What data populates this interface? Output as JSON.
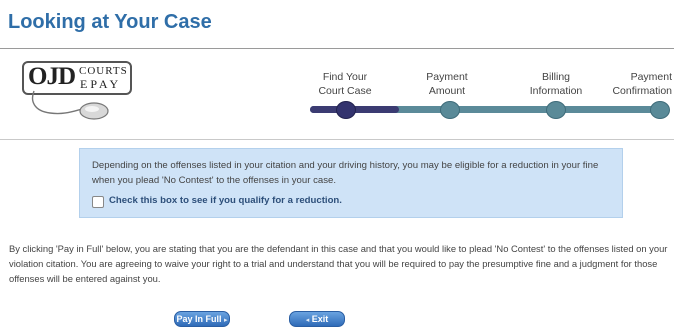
{
  "page": {
    "title": "Looking at Your Case"
  },
  "logo": {
    "main": "OJD",
    "top": "COURTS",
    "bottom": "EPAY"
  },
  "steps": [
    {
      "line1": "Find Your",
      "line2": "Court Case"
    },
    {
      "line1": "Payment",
      "line2": "Amount"
    },
    {
      "line1": "Billing",
      "line2": "Information"
    },
    {
      "line1": "Payment",
      "line2": "Confirmation"
    }
  ],
  "progress": {
    "current_step": 1,
    "total_steps": 4,
    "fill_fraction": 0.25
  },
  "notice": {
    "text": "Depending on the offenses listed in your citation and your driving history, you may be eligible for a reduction in your fine when you plead 'No Contest' to the offenses in your case.",
    "checkbox_label": "Check this box to see if you qualify for a reduction.",
    "checked": false
  },
  "legal_text": "By clicking 'Pay in Full' below, you are stating that you are the defendant in this case and that you would like to plead 'No Contest' to the offenses listed on your violation citation. You are agreeing to waive your right to a trial and understand that you will be required to pay the presumptive fine and a judgment for those offenses will be entered against you.",
  "buttons": {
    "pay_in_full": "Pay In Full",
    "exit": "Exit"
  },
  "colors": {
    "title": "#2f6ea8",
    "notice_bg": "#cfe3f7",
    "progress_done": "#33336e",
    "progress_todo": "#5a8a98",
    "button": "#2f6bb8"
  }
}
